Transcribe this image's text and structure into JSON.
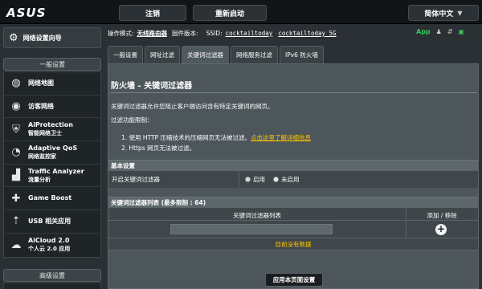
{
  "header": {
    "logo": "ASUS",
    "logout_label": "注销",
    "reboot_label": "重新启动",
    "language": "简体中文"
  },
  "sidebar": {
    "qis_label": "网络设置向导",
    "general_title": "一般设置",
    "items": [
      {
        "icon": "globe-icon",
        "l1": "网络地图",
        "l2": ""
      },
      {
        "icon": "guest-network-icon",
        "l1": "访客网络",
        "l2": ""
      },
      {
        "icon": "shield-icon",
        "l1": "AiProtection",
        "l2": "智能网络卫士"
      },
      {
        "icon": "speedometer-icon",
        "l1": "Adaptive QoS",
        "l2": "网络监控家"
      },
      {
        "icon": "chart-icon",
        "l1": "Traffic Analyzer",
        "l2": "流量分析"
      },
      {
        "icon": "gamepad-icon",
        "l1": "Game Boost",
        "l2": ""
      },
      {
        "icon": "usb-icon",
        "l1": "USB 相关应用",
        "l2": ""
      },
      {
        "icon": "cloud-icon",
        "l1": "AiCloud 2.0",
        "l2": "个人云 2.0 应用"
      }
    ],
    "advanced_title": "高级设置"
  },
  "status": {
    "mode_label": "操作模式:",
    "mode_value": "无线路由器",
    "fw_label": "固件版本:",
    "ssid_label": "SSID:",
    "ssid_1": "cocktailtoday",
    "ssid_2": "cocktailtoday_5G",
    "app_label": "App"
  },
  "tabs": [
    {
      "label": "一般设置",
      "active": false
    },
    {
      "label": "网址过滤",
      "active": false
    },
    {
      "label": "关键词过滤器",
      "active": true
    },
    {
      "label": "网络服务过滤",
      "active": false
    },
    {
      "label": "IPv6 防火墙",
      "active": false
    }
  ],
  "panel": {
    "title": "防火墙 - 关键词过滤器",
    "description": "关键词过滤器允许您阻止客户端访问含有特定关键词的网页。",
    "limits_title": "过滤功能限制：",
    "limit_1_prefix": "1. 使用 HTTP 压缩技术的压缩网页无法被过滤。",
    "limit_1_link": "点击这里了解详细信息",
    "limit_2": "2. Https 网页无法被过滤。",
    "basic_section": "基本设置",
    "enable_label": "开启关键词过滤器",
    "radio_on": "启用",
    "radio_off": "未启用",
    "list_section": "关键词过滤器列表 (最多限制 : 64)",
    "col_list": "关键词过滤器列表",
    "col_action": "添加 / 移除",
    "empty_text": "目前没有数据",
    "apply_label": "应用本页面设置"
  },
  "colors": {
    "background": "#23282b",
    "panel": "#4d565b",
    "highlight": "#ffc400",
    "app": "#34c759"
  }
}
